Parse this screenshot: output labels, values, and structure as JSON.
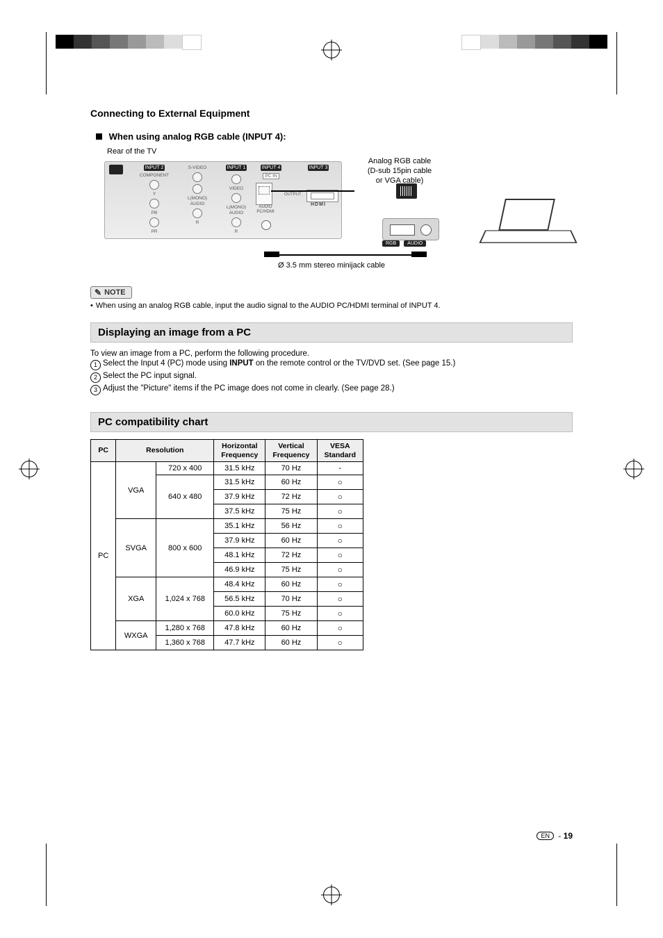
{
  "header": {
    "title": "Connecting to External Equipment"
  },
  "section1": {
    "heading": "When using analog RGB cable (INPUT 4):",
    "rear_label": "Rear of the TV",
    "cable_label": "Analog RGB cable\n(D-sub 15pin cable\nor VGA cable)",
    "audio_cable": "Ø 3.5 mm stereo minijack cable",
    "panel": {
      "input2": "INPUT 2",
      "component": "COMPONENT",
      "svideo": "S-VIDEO",
      "input1": "INPUT 1",
      "video": "VIDEO",
      "lmono": "L(MONO)",
      "audio": "AUDIO",
      "r": "R",
      "y": "Y",
      "pb": "PB",
      "pr": "PR",
      "input4": "INPUT 4",
      "pcin": "PC IN",
      "audio_pc": "AUDIO\nPC/HDMI",
      "input3": "INPUT 3",
      "output": "OUTPUT",
      "hdmi": "HDMI"
    },
    "pc_ports": {
      "rgb": "RGB",
      "audio": "AUDIO"
    }
  },
  "note": {
    "badge": "NOTE",
    "text": "When using an analog RGB cable, input the audio signal to the AUDIO PC/HDMI terminal of INPUT 4."
  },
  "section2": {
    "heading": "Displaying an image from a PC",
    "intro": "To view an image from a PC, perform the following procedure.",
    "steps": [
      "Select the Input 4 (PC) mode using INPUT on the remote control or the TV/DVD set. (See page 15.)",
      "Select the PC input signal.",
      "Adjust the \"Picture\" items if the PC image does not come in clearly.  (See page 28.)"
    ],
    "input_bold": "INPUT"
  },
  "section3": {
    "heading": "PC compatibility chart",
    "columns": [
      "PC",
      "Resolution",
      "Horizontal Frequency",
      "Vertical Frequency",
      "VESA Standard"
    ],
    "pc_label": "PC",
    "groups": [
      {
        "name": "VGA",
        "rows": [
          {
            "res": "720 x 400",
            "h": "31.5 kHz",
            "v": "70 Hz",
            "vesa": "-"
          },
          {
            "res": "640 x 480",
            "h": "31.5 kHz",
            "v": "60 Hz",
            "vesa": "○"
          },
          {
            "res": "",
            "h": "37.9 kHz",
            "v": "72 Hz",
            "vesa": "○"
          },
          {
            "res": "",
            "h": "37.5 kHz",
            "v": "75 Hz",
            "vesa": "○"
          }
        ],
        "res_merge": [
          "720 x 400",
          "640 x 480"
        ]
      },
      {
        "name": "SVGA",
        "rows": [
          {
            "res": "800 x 600",
            "h": "35.1 kHz",
            "v": "56 Hz",
            "vesa": "○"
          },
          {
            "res": "",
            "h": "37.9 kHz",
            "v": "60 Hz",
            "vesa": "○"
          },
          {
            "res": "",
            "h": "48.1 kHz",
            "v": "72 Hz",
            "vesa": "○"
          },
          {
            "res": "",
            "h": "46.9 kHz",
            "v": "75 Hz",
            "vesa": "○"
          }
        ]
      },
      {
        "name": "XGA",
        "rows": [
          {
            "res": "1,024 x 768",
            "h": "48.4 kHz",
            "v": "60 Hz",
            "vesa": "○"
          },
          {
            "res": "",
            "h": "56.5 kHz",
            "v": "70 Hz",
            "vesa": "○"
          },
          {
            "res": "",
            "h": "60.0 kHz",
            "v": "75 Hz",
            "vesa": "○"
          }
        ]
      },
      {
        "name": "WXGA",
        "rows": [
          {
            "res": "1,280 x 768",
            "h": "47.8 kHz",
            "v": "60 Hz",
            "vesa": "○"
          },
          {
            "res": "1,360 x 768",
            "h": "47.7 kHz",
            "v": "60 Hz",
            "vesa": "○"
          }
        ]
      }
    ]
  },
  "footer": {
    "lang": "EN",
    "sep": "-",
    "page": "19"
  },
  "colorbar_left": [
    "#000",
    "#333",
    "#555",
    "#777",
    "#999",
    "#bbb",
    "#ddd",
    "#fff"
  ],
  "colorbar_right": [
    "#fff",
    "#ddd",
    "#bbb",
    "#999",
    "#777",
    "#555",
    "#333",
    "#000"
  ],
  "chart_data": {
    "type": "table",
    "title": "PC compatibility chart",
    "columns": [
      "PC",
      "Resolution Class",
      "Resolution",
      "Horizontal Frequency",
      "Vertical Frequency",
      "VESA Standard"
    ],
    "rows": [
      [
        "PC",
        "VGA",
        "720 x 400",
        "31.5 kHz",
        "70 Hz",
        "-"
      ],
      [
        "PC",
        "VGA",
        "640 x 480",
        "31.5 kHz",
        "60 Hz",
        "○"
      ],
      [
        "PC",
        "VGA",
        "640 x 480",
        "37.9 kHz",
        "72 Hz",
        "○"
      ],
      [
        "PC",
        "VGA",
        "640 x 480",
        "37.5 kHz",
        "75 Hz",
        "○"
      ],
      [
        "PC",
        "SVGA",
        "800 x 600",
        "35.1 kHz",
        "56 Hz",
        "○"
      ],
      [
        "PC",
        "SVGA",
        "800 x 600",
        "37.9 kHz",
        "60 Hz",
        "○"
      ],
      [
        "PC",
        "SVGA",
        "800 x 600",
        "48.1 kHz",
        "72 Hz",
        "○"
      ],
      [
        "PC",
        "SVGA",
        "800 x 600",
        "46.9 kHz",
        "75 Hz",
        "○"
      ],
      [
        "PC",
        "XGA",
        "1,024 x 768",
        "48.4 kHz",
        "60 Hz",
        "○"
      ],
      [
        "PC",
        "XGA",
        "1,024 x 768",
        "56.5 kHz",
        "70 Hz",
        "○"
      ],
      [
        "PC",
        "XGA",
        "1,024 x 768",
        "60.0 kHz",
        "75 Hz",
        "○"
      ],
      [
        "PC",
        "WXGA",
        "1,280 x 768",
        "47.8 kHz",
        "60 Hz",
        "○"
      ],
      [
        "PC",
        "WXGA",
        "1,360 x 768",
        "47.7 kHz",
        "60 Hz",
        "○"
      ]
    ]
  }
}
